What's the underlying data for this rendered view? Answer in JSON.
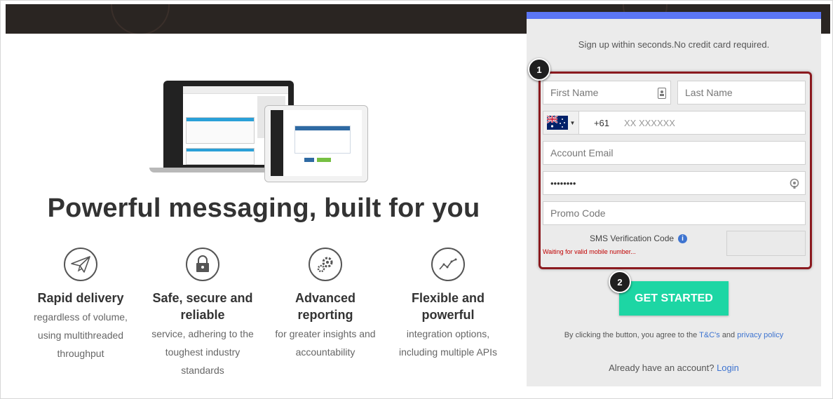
{
  "hero": {},
  "left": {
    "headline": "Powerful messaging, built for you",
    "features": [
      {
        "icon": "paper-plane-icon",
        "title_lines": [
          "Rapid delivery"
        ],
        "desc_lines": [
          "regardless of volume,",
          "using multithreaded",
          "throughput"
        ]
      },
      {
        "icon": "padlock-icon",
        "title_lines": [
          "Safe, secure and",
          "reliable"
        ],
        "desc_lines": [
          "service, adhering to the",
          "toughest industry",
          "standards"
        ]
      },
      {
        "icon": "gears-icon",
        "title_lines": [
          "Advanced",
          "reporting"
        ],
        "desc_lines": [
          "for greater insights and",
          "accountability"
        ]
      },
      {
        "icon": "chart-line-icon",
        "title_lines": [
          "Flexible and",
          "powerful"
        ],
        "desc_lines": [
          "integration options,",
          "including multiple APIs"
        ]
      }
    ]
  },
  "signup": {
    "accent_color": "#5b76f5",
    "tagline": "Sign up within seconds.No credit card required.",
    "first_name_placeholder": "First Name",
    "last_name_placeholder": "Last Name",
    "country_flag": "australia-flag-icon",
    "dial_code": "+61",
    "phone_placeholder": "XX XXXXXX",
    "email_placeholder": "Account Email",
    "password_value": "••••••••",
    "promo_placeholder": "Promo Code",
    "sms_label": "SMS Verification Code",
    "sms_status": "Waiting for valid mobile number...",
    "sms_status_color": "#c00000",
    "button_label": "GET STARTED",
    "button_color": "#1dd6a4",
    "terms_prefix": "By clicking the button, you agree to the",
    "terms_link": "T&C's",
    "terms_and": "and",
    "privacy_link": "privacy policy",
    "login_prefix": "Already have an account?",
    "login_link": "Login"
  },
  "annotations": {
    "marker_1": "1",
    "marker_2": "2",
    "highlight_color": "#8b1a1f"
  }
}
